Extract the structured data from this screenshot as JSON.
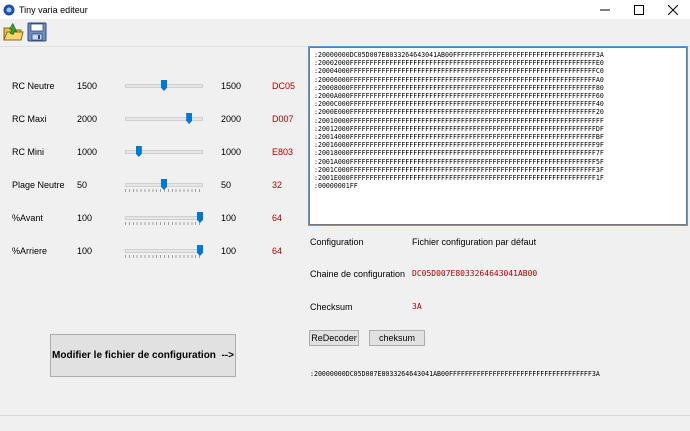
{
  "window": {
    "title": "Tiny varia editeur"
  },
  "parameters": [
    {
      "label": "RC Neutre",
      "value": "1500",
      "value2": "1500",
      "hex": "DC05",
      "level": 0.5
    },
    {
      "label": "RC Maxi",
      "value": "2000",
      "value2": "2000",
      "hex": "D007",
      "level": 0.85
    },
    {
      "label": "RC Mini",
      "value": "1000",
      "value2": "1000",
      "hex": "E803",
      "level": 0.15
    },
    {
      "label": "Plage Neutre",
      "value": "50",
      "value2": "50",
      "hex": "32",
      "level": 0.5
    },
    {
      "label": "%Avant",
      "value": "100",
      "value2": "100",
      "hex": "64",
      "level": 1.0
    },
    {
      "label": "%Arriere",
      "value": "100",
      "value2": "100",
      "hex": "64",
      "level": 1.0
    }
  ],
  "modify_button_label": "Modifier le fichier de configuration  -->",
  "hex_lines": [
    ":20000000DC05D007E8033264643041AB00FFFFFFFFFFFFFFFFFFFFFFFFFFFFFFFFFFFF3A",
    ":20002000FFFFFFFFFFFFFFFFFFFFFFFFFFFFFFFFFFFFFFFFFFFFFFFFFFFFFFFFFFFFFFE0",
    ":20004000FFFFFFFFFFFFFFFFFFFFFFFFFFFFFFFFFFFFFFFFFFFFFFFFFFFFFFFFFFFFFFC0",
    ":20006000FFFFFFFFFFFFFFFFFFFFFFFFFFFFFFFFFFFFFFFFFFFFFFFFFFFFFFFFFFFFFFA0",
    ":20008000FFFFFFFFFFFFFFFFFFFFFFFFFFFFFFFFFFFFFFFFFFFFFFFFFFFFFFFFFFFFFF80",
    ":2000A000FFFFFFFFFFFFFFFFFFFFFFFFFFFFFFFFFFFFFFFFFFFFFFFFFFFFFFFFFFFFFF60",
    ":2000C000FFFFFFFFFFFFFFFFFFFFFFFFFFFFFFFFFFFFFFFFFFFFFFFFFFFFFFFFFFFFFF40",
    ":2000E000FFFFFFFFFFFFFFFFFFFFFFFFFFFFFFFFFFFFFFFFFFFFFFFFFFFFFFFFFFFFFF20",
    ":20010000FFFFFFFFFFFFFFFFFFFFFFFFFFFFFFFFFFFFFFFFFFFFFFFFFFFFFFFFFFFFFFFF",
    ":20012000FFFFFFFFFFFFFFFFFFFFFFFFFFFFFFFFFFFFFFFFFFFFFFFFFFFFFFFFFFFFFFDF",
    ":20014000FFFFFFFFFFFFFFFFFFFFFFFFFFFFFFFFFFFFFFFFFFFFFFFFFFFFFFFFFFFFFFBF",
    ":20016000FFFFFFFFFFFFFFFFFFFFFFFFFFFFFFFFFFFFFFFFFFFFFFFFFFFFFFFFFFFFFF9F",
    ":20018000FFFFFFFFFFFFFFFFFFFFFFFFFFFFFFFFFFFFFFFFFFFFFFFFFFFFFFFFFFFFFF7F",
    ":2001A000FFFFFFFFFFFFFFFFFFFFFFFFFFFFFFFFFFFFFFFFFFFFFFFFFFFFFFFFFFFFFF5F",
    ":2001C000FFFFFFFFFFFFFFFFFFFFFFFFFFFFFFFFFFFFFFFFFFFFFFFFFFFFFFFFFFFFFF3F",
    ":2001E000FFFFFFFFFFFFFFFFFFFFFFFFFFFFFFFFFFFFFFFFFFFFFFFFFFFFFFFFFFFFFF1F",
    ":00000001FF"
  ],
  "config": {
    "label": "Configuration",
    "value": "Fichier configuration par défaut",
    "chain_label": "Chaine de configuration",
    "chain_value": "DC05D007E8033264643041AB00",
    "checksum_label": "Checksum",
    "checksum_value": "3A"
  },
  "buttons": {
    "redecoder": "ReDecoder",
    "checksum": "cheksum"
  },
  "output_line": ":20000000DC05D007E8033264643041AB00FFFFFFFFFFFFFFFFFFFFFFFFFFFFFFFFFFFF3A",
  "colors": {
    "hex_red": "#b00000",
    "slider_thumb": "#0078d7",
    "focus_border": "#5b9bd5"
  },
  "icons": {
    "app": "app-icon",
    "open": "open-folder-icon",
    "save": "save-disk-icon"
  }
}
